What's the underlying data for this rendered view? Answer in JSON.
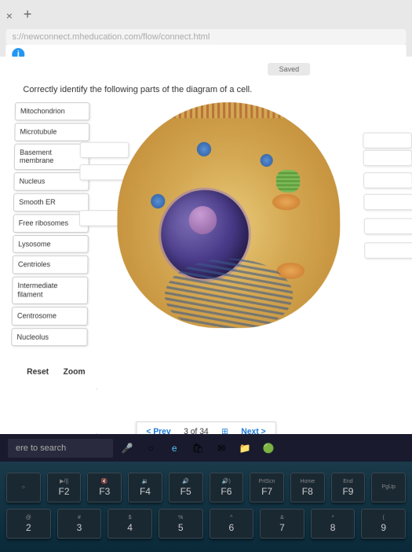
{
  "browser": {
    "url": "s://newconnect.mheducation.com/flow/connect.html",
    "tab_close": "×",
    "new_tab": "+"
  },
  "info_icon": "i",
  "status": {
    "saved": "Saved"
  },
  "question": "Correctly identify the following parts of the diagram of a cell.",
  "labels": [
    "Mitochondrion",
    "Microtubule",
    "Basement membrane",
    "Nucleus",
    "Smooth ER",
    "Free ribosomes",
    "Lysosome",
    "Centrioles",
    "Intermediate filament",
    "Centrosome",
    "Nucleolus"
  ],
  "controls": {
    "reset": "Reset",
    "zoom": "Zoom"
  },
  "nav": {
    "prev": "< Prev",
    "progress": "3 of 34",
    "next": "Next >"
  },
  "taskbar": {
    "search": "ere to search"
  },
  "keyboard": {
    "row1": [
      {
        "main": "",
        "sub": "☼"
      },
      {
        "main": "F2",
        "sub": "▶/||"
      },
      {
        "main": "F3",
        "sub": "🔇"
      },
      {
        "main": "F4",
        "sub": "🔉"
      },
      {
        "main": "F5",
        "sub": "🔊"
      },
      {
        "main": "F6",
        "sub": "🔊)"
      },
      {
        "main": "F7",
        "sub": "PrtScn"
      },
      {
        "main": "F8",
        "sub": "Home"
      },
      {
        "main": "F9",
        "sub": "End"
      },
      {
        "main": "",
        "sub": "PgUp"
      }
    ],
    "row2": [
      {
        "main": "2",
        "sub": "@"
      },
      {
        "main": "3",
        "sub": "#"
      },
      {
        "main": "4",
        "sub": "$"
      },
      {
        "main": "5",
        "sub": "%"
      },
      {
        "main": "6",
        "sub": "^"
      },
      {
        "main": "7",
        "sub": "&"
      },
      {
        "main": "8",
        "sub": "*"
      },
      {
        "main": "9",
        "sub": "("
      }
    ]
  }
}
